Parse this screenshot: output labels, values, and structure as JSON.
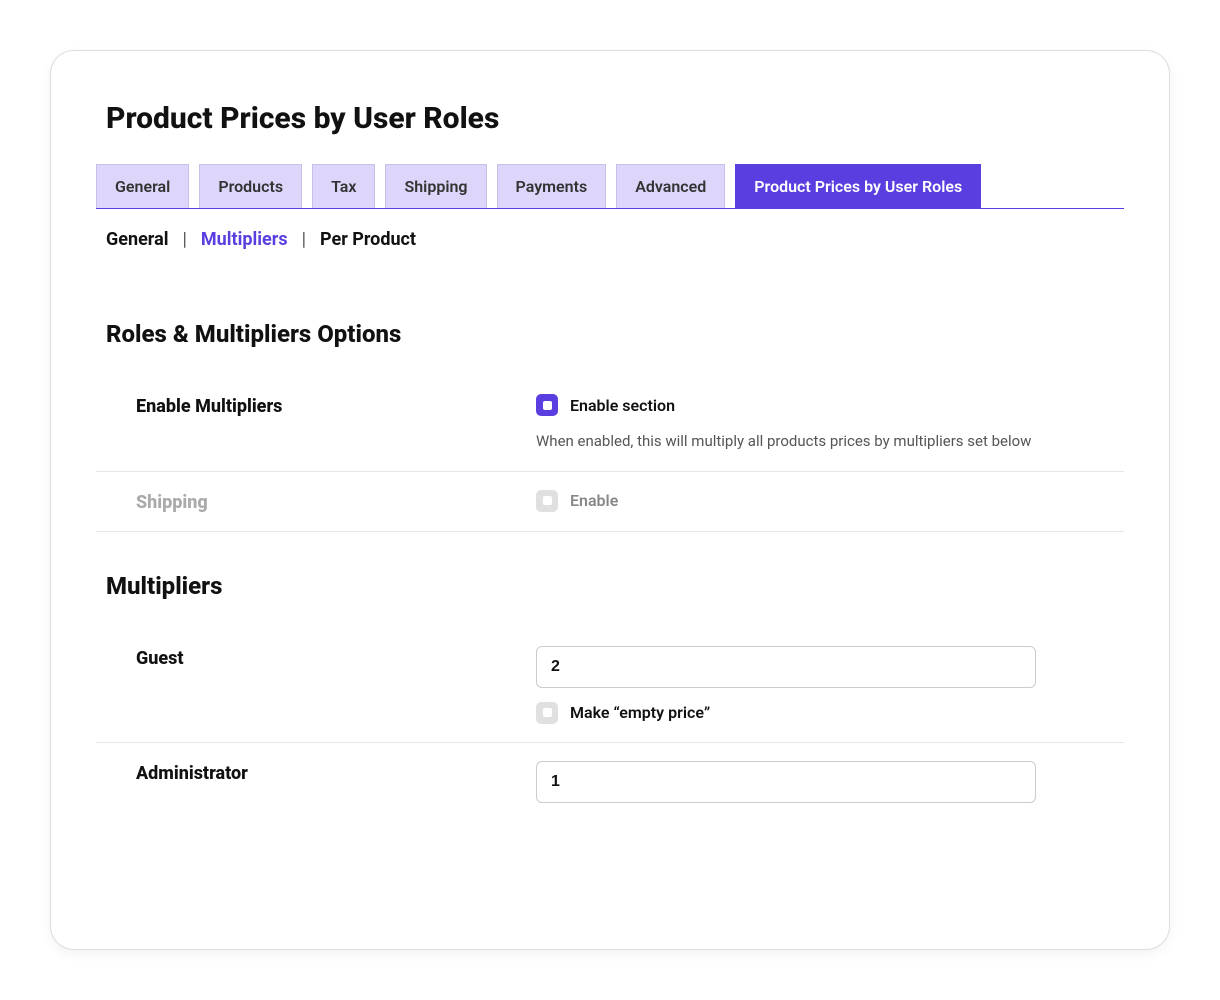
{
  "page_title": "Product Prices by User Roles",
  "tabs": [
    {
      "label": "General"
    },
    {
      "label": "Products"
    },
    {
      "label": "Tax"
    },
    {
      "label": "Shipping"
    },
    {
      "label": "Payments"
    },
    {
      "label": "Advanced"
    },
    {
      "label": "Product Prices by User Roles"
    }
  ],
  "subtabs": {
    "general": "General",
    "multipliers": "Multipliers",
    "per_product": "Per Product"
  },
  "sections": {
    "roles_multipliers_heading": "Roles & Multipliers Options",
    "multipliers_heading": "Multipliers"
  },
  "enable_multipliers": {
    "label": "Enable Multipliers",
    "check_label": "Enable section",
    "help": "When enabled, this will multiply all products prices by multipliers set below"
  },
  "shipping": {
    "label": "Shipping",
    "check_label": "Enable"
  },
  "guest": {
    "label": "Guest",
    "value": "2",
    "empty_label": "Make “empty price”"
  },
  "administrator": {
    "label": "Administrator",
    "value": "1"
  }
}
